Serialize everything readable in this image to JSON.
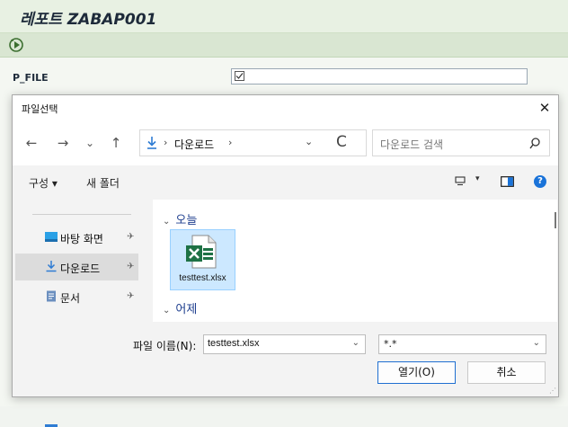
{
  "sap": {
    "title": "레포트 ZABAP001",
    "param_label": "P_FILE"
  },
  "dialog": {
    "title": "파일선택",
    "close_glyph": "✕",
    "nav": {
      "back": "←",
      "forward": "→",
      "recent": "⌄",
      "up": "↑",
      "path_sep": "›",
      "location": "다운로드",
      "refresh": "C",
      "dropdown": "⌄"
    },
    "search_placeholder": "다운로드 검색",
    "commands": {
      "organize": "구성 ▾",
      "new_folder": "새 폴더",
      "view_dropdown": "▾",
      "help": "?"
    },
    "nav_pane": [
      {
        "label": "바탕 화면",
        "icon": "desktop-icon",
        "color": "#2aa0e6"
      },
      {
        "label": "다운로드",
        "icon": "download-icon",
        "color": "#2f7cd3",
        "selected": true
      },
      {
        "label": "문서",
        "icon": "document-icon",
        "color": "#6b8fbf"
      }
    ],
    "pin_glyph": "✈",
    "groups": [
      {
        "label": "오늘",
        "chevron": "⌄"
      },
      {
        "label": "어제",
        "chevron": "⌄"
      }
    ],
    "file": {
      "name": "testtest.xlsx",
      "icon": "excel-icon",
      "color": "#1e7145"
    },
    "filename_label": "파일 이름(N):",
    "filename_value": "testtest.xlsx",
    "filetype_value": "*.*",
    "open_button": "열기(O)",
    "cancel_button": "취소"
  }
}
